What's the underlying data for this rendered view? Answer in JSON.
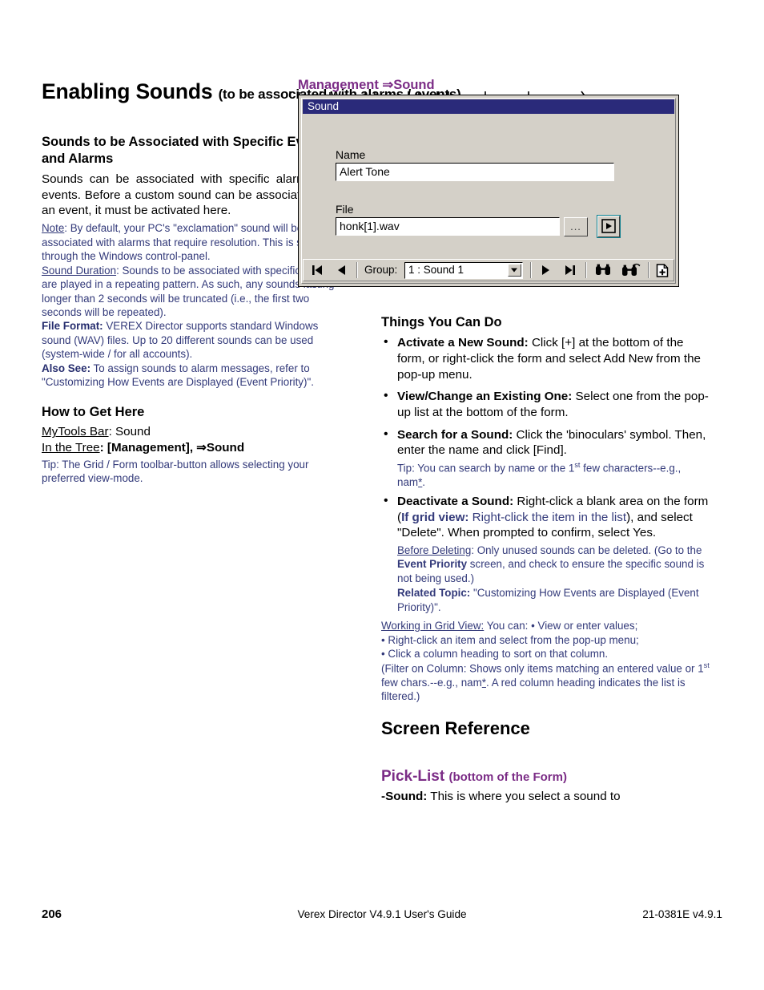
{
  "page": {
    "heading": "Enabling Sounds",
    "heading_sub": "(to be associated with alarms / events)",
    "callout": "Management ⇒Sound"
  },
  "left": {
    "section_title": "Sounds to be Associated with Specific Events and Alarms",
    "intro": "Sounds can be associated with specific alarms and events.  Before a custom sound can be associated with an event, it must be activated here.",
    "note_label": "Note",
    "note_text": ":  By default, your PC's \"exclamation\" sound will be associated with alarms that require resolution.  This is set through the Windows control-panel.",
    "duration_label": "Sound Duration",
    "duration_text": ":  Sounds to be associated with specific alarms are played in a repeating pattern.  As such, any sounds lasting longer than 2 seconds will be truncated (i.e., the first two seconds will be repeated).",
    "fileformat_label": "File Format:",
    "fileformat_text": "  VEREX Director supports standard Windows sound (WAV) files.  Up to 20 different sounds can be used (system-wide / for all accounts).",
    "alsosee_label": "Also See:",
    "alsosee_text": "  To assign sounds to alarm messages, refer to \"Customizing How Events are Displayed (Event Priority)\".",
    "howto_title": "How to Get Here",
    "mytools_label": "MyTools Bar",
    "mytools_value": ":  Sound",
    "tree_label": "In the Tree",
    "tree_value_a": ":  [Management], ",
    "tree_arrow": "⇒",
    "tree_value_b": "Sound",
    "howto_tip": "Tip:  The Grid / Form toolbar-button allows selecting your preferred view-mode."
  },
  "right": {
    "things_title": "Things You Can Do",
    "bullets": [
      {
        "label": "Activate a New Sound:",
        "text": "  Click [+] at the bottom of the form, or right-click the form and select Add New from the pop-up menu."
      },
      {
        "label": "View/Change an Existing One:",
        "text": "  Select one from the pop-up list at the bottom of the form."
      },
      {
        "label": "Search for a Sound:",
        "text": "  Click the 'binoculars' symbol.  Then, enter the name and click [Find]."
      }
    ],
    "search_tip_a": "Tip:  You can search by name or the 1",
    "search_tip_sup": "st",
    "search_tip_b": " few characters--e.g., nam",
    "search_tip_star": "*",
    "search_tip_c": ".",
    "deactivate_label": "Deactivate a Sound:",
    "deactivate_a": "  Right-click a blank area on the form (",
    "deactivate_grid_label": "If grid view:",
    "deactivate_grid_text": " Right-click the item in the list",
    "deactivate_b": "), and select \"Delete\".  When prompted to confirm, select Yes.",
    "before_label": "Before Deleting",
    "before_a": ":  Only unused sounds can be deleted.  (Go to the ",
    "before_bold": "Event Priority",
    "before_b": " screen, and check to ensure the specific sound is not being used.)",
    "related_label": "Related Topic:",
    "related_text": "  \"Customizing How Events are Displayed (Event Priority)\".",
    "gridview_label": "Working in Grid View:",
    "gridview_line1": "  You can:  • View or enter values;",
    "gridview_line2": "• Right-click an item and select from the pop-up menu;",
    "gridview_line3": "• Click a column heading to sort on that column.",
    "gridview_line4a": "(Filter on Column:  Shows only items matching an entered value or 1",
    "gridview_sup": "st",
    "gridview_line4b": " few chars.--e.g., nam",
    "gridview_star": "*",
    "gridview_line4c": ".  A red column heading indicates the list is filtered.)",
    "screen_reference": "Screen Reference",
    "picklist_title": "Pick-List",
    "picklist_sub": "(bottom of the Form)",
    "picklist_dash": "-",
    "picklist_item_label": "Sound:",
    "picklist_item_text": " This is where you select a sound to"
  },
  "dialog": {
    "title": "Sound",
    "name_label": "Name",
    "name_value": "Alert Tone",
    "file_label": "File",
    "file_value": "honk[1].wav",
    "browse_label": "...",
    "play_label": "play-button",
    "group_label": "Group:",
    "group_value": "1 : Sound 1",
    "nav_first": "first-record",
    "nav_prev": "previous-record",
    "nav_next": "next-record",
    "nav_last": "last-record",
    "find": "find",
    "find_next": "find-next",
    "add_new": "add-new-record"
  },
  "footer": {
    "page_number": "206",
    "center": "Verex Director V4.9.1 User's Guide",
    "right": "21-0381E v4.9.1"
  },
  "colors": {
    "accent_purple": "#7B2C86",
    "note_blue": "#333a7a",
    "dialog_face": "#d4d0c8",
    "titlebar": "#2a2a7a"
  }
}
